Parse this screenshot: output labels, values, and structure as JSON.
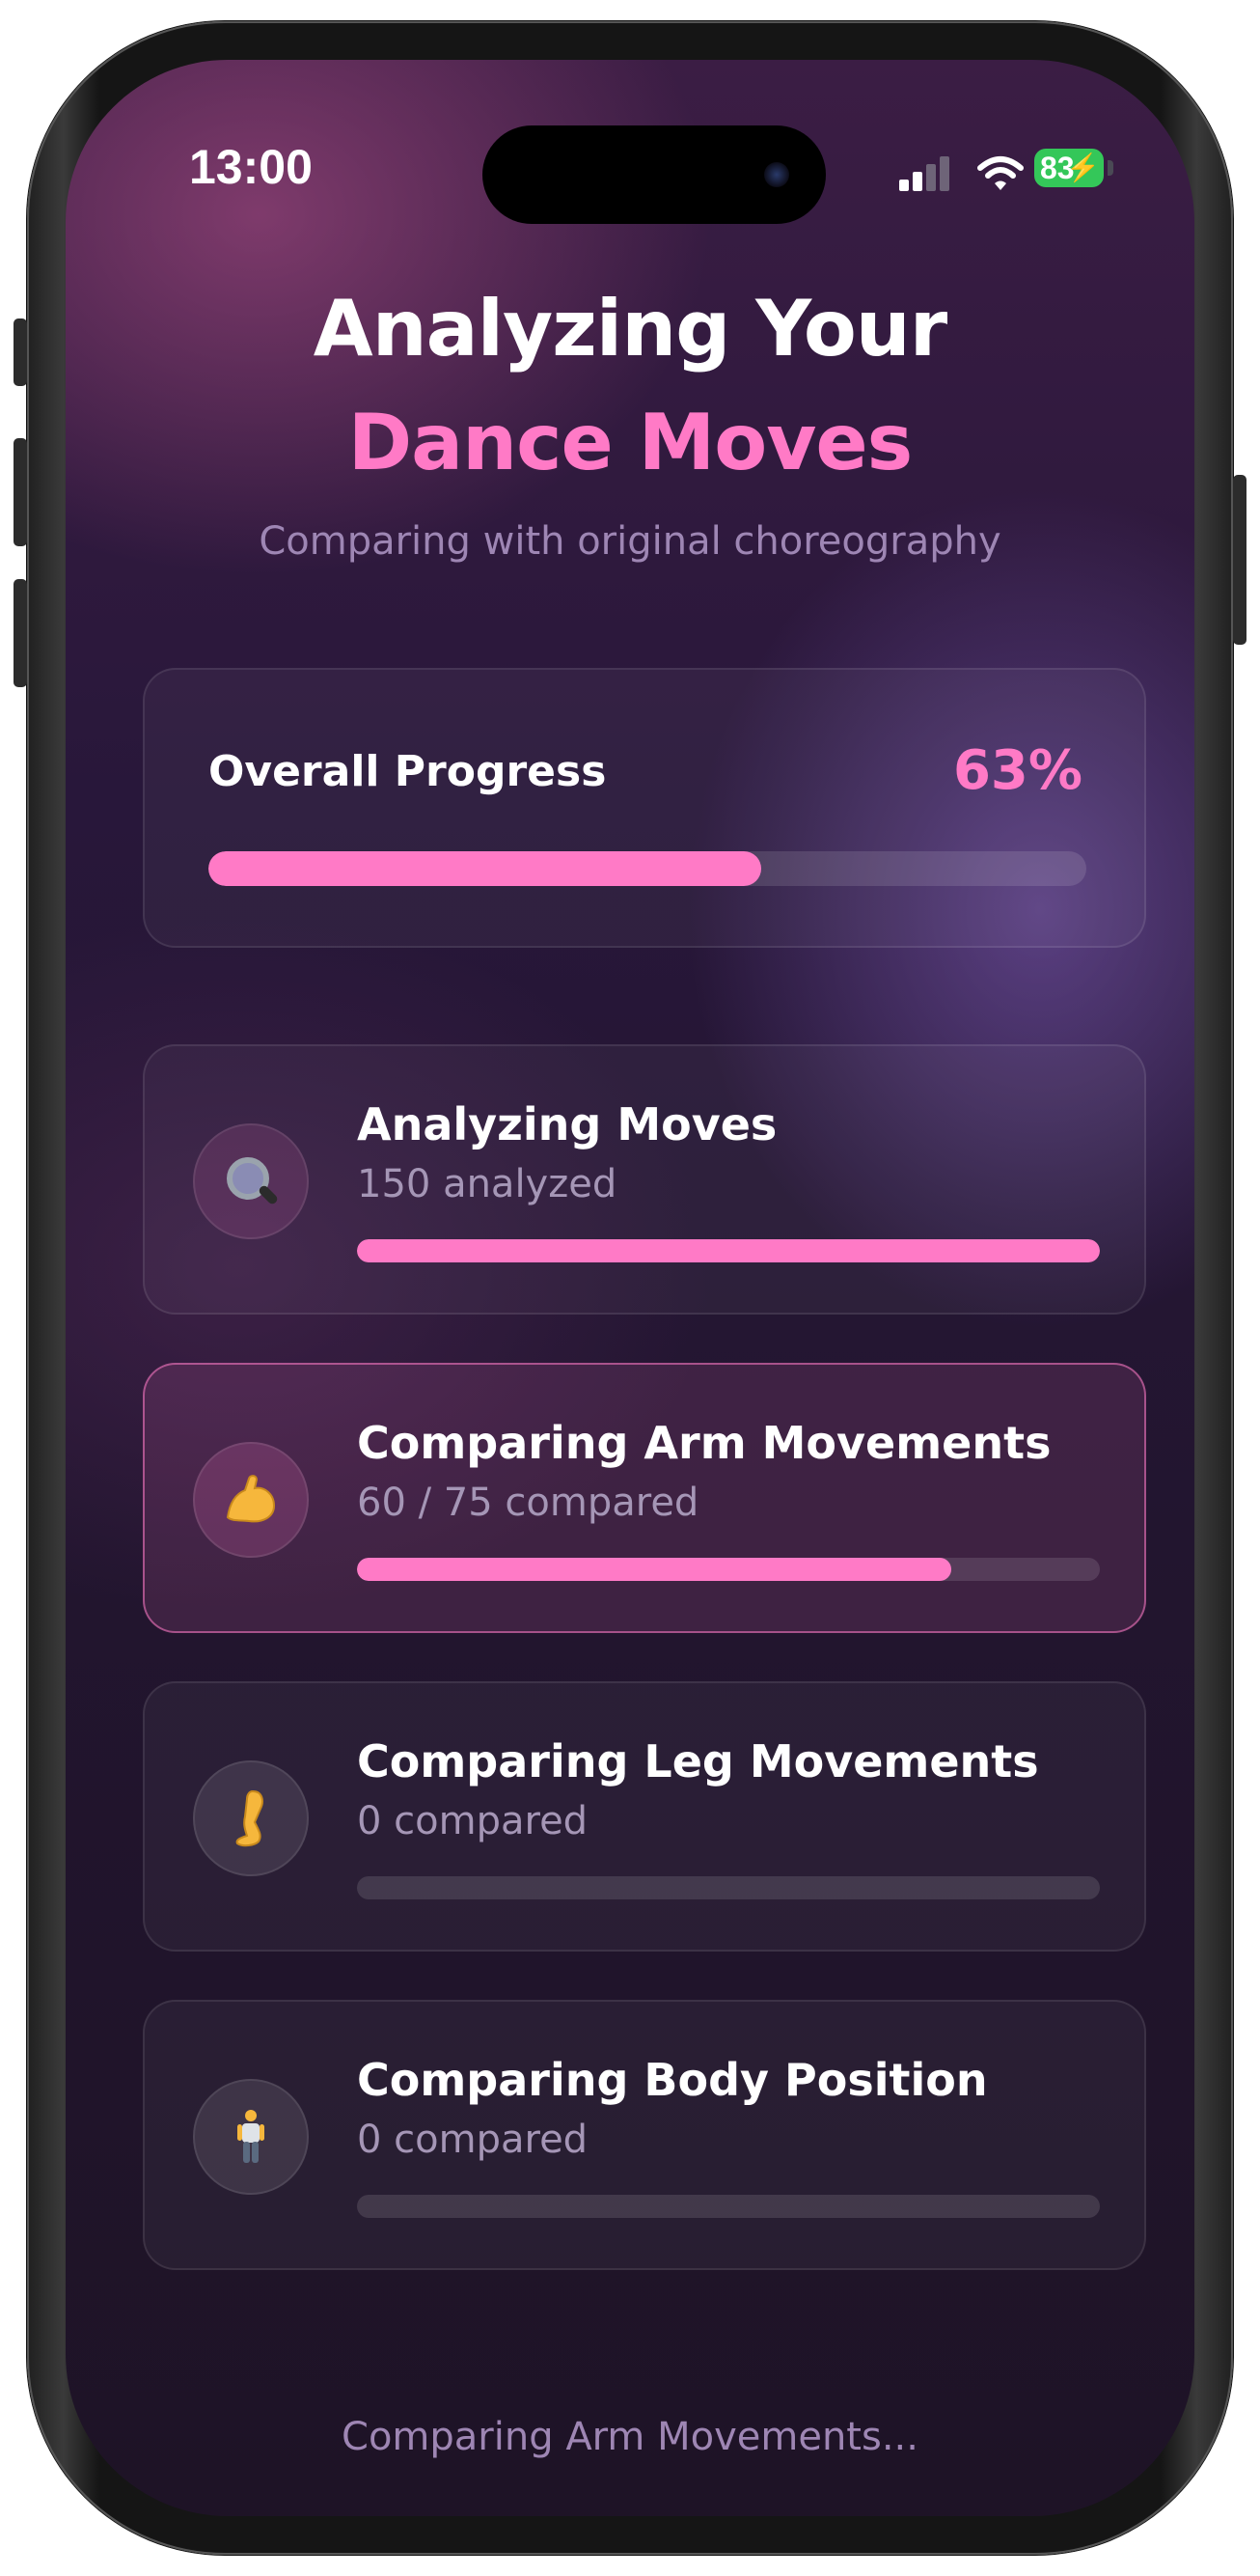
{
  "status_bar": {
    "time": "13:00",
    "battery": "83"
  },
  "header": {
    "title_line1": "Analyzing Your",
    "title_line2": "Dance Moves",
    "subtitle": "Comparing with original choreography"
  },
  "overall": {
    "label": "Overall Progress",
    "percent_text": "63%",
    "progress": 0.63
  },
  "steps": [
    {
      "icon": "magnifier-icon",
      "title": "Analyzing Moves",
      "subtitle": "150 analyzed",
      "progress": 1.0,
      "state": "done"
    },
    {
      "icon": "flexed-biceps-icon",
      "title": "Comparing Arm Movements",
      "subtitle": "60 / 75 compared",
      "progress": 0.8,
      "state": "active"
    },
    {
      "icon": "leg-icon",
      "title": "Comparing Leg Movements",
      "subtitle": "0 compared",
      "progress": 0,
      "state": "pending"
    },
    {
      "icon": "standing-person-icon",
      "title": "Comparing Body Position",
      "subtitle": "0 compared",
      "progress": 0,
      "state": "pending"
    }
  ],
  "footer": {
    "status_text": "Comparing Arm Movements..."
  },
  "colors": {
    "accent": "#ff7ac6",
    "battery": "#34c759",
    "muted_text": "#9e86b4"
  }
}
